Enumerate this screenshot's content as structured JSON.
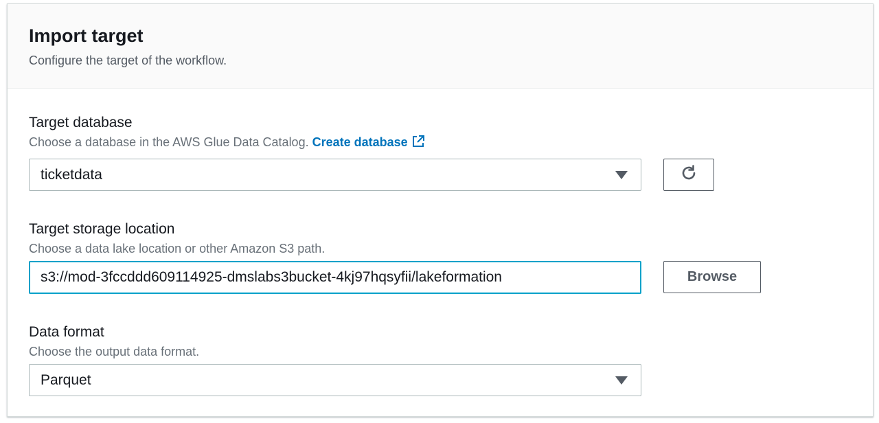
{
  "header": {
    "title": "Import target",
    "description": "Configure the target of the workflow."
  },
  "target_database": {
    "label": "Target database",
    "description": "Choose a database in the AWS Glue Data Catalog.",
    "link_label": "Create database",
    "link_icon": "external-link-icon",
    "selected_value": "ticketdata",
    "refresh_icon": "refresh-icon"
  },
  "target_storage": {
    "label": "Target storage location",
    "description": "Choose a data lake location or other Amazon S3 path.",
    "value": "s3://mod-3fccddd609114925-dmslabs3bucket-4kj97hqsyfii/lakeformation",
    "browse_label": "Browse"
  },
  "data_format": {
    "label": "Data format",
    "description": "Choose the output data format.",
    "selected_value": "Parquet"
  },
  "colors": {
    "link": "#0073bb",
    "focus_border": "#00a1c9",
    "header_bg": "#fafafa"
  }
}
